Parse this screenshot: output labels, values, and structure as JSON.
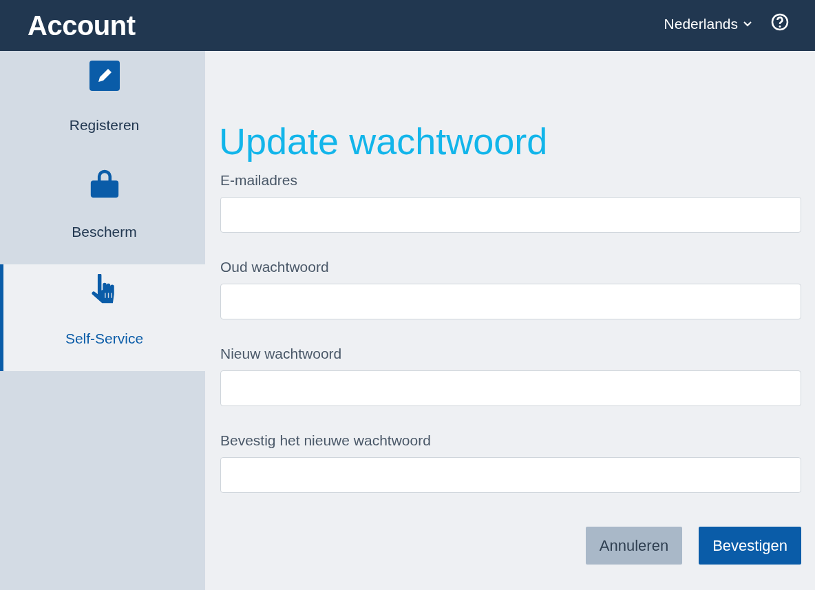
{
  "header": {
    "title": "Account",
    "language": "Nederlands"
  },
  "sidebar": {
    "items": [
      {
        "label": "Registeren",
        "kind": "pencil",
        "selected": false
      },
      {
        "label": "Bescherm",
        "kind": "lock",
        "selected": false
      },
      {
        "label": "Self-Service",
        "kind": "hand",
        "selected": true
      }
    ]
  },
  "form": {
    "title": "Update wachtwoord",
    "fields": [
      {
        "label": "E-mailadres"
      },
      {
        "label": "Oud wachtwoord"
      },
      {
        "label": "Nieuw wachtwoord"
      },
      {
        "label": "Bevestig het nieuwe wachtwoord"
      }
    ],
    "buttons": [
      {
        "label": "Annuleren",
        "kind": "secondary"
      },
      {
        "label": "Bevestigen",
        "kind": "primary"
      }
    ]
  }
}
